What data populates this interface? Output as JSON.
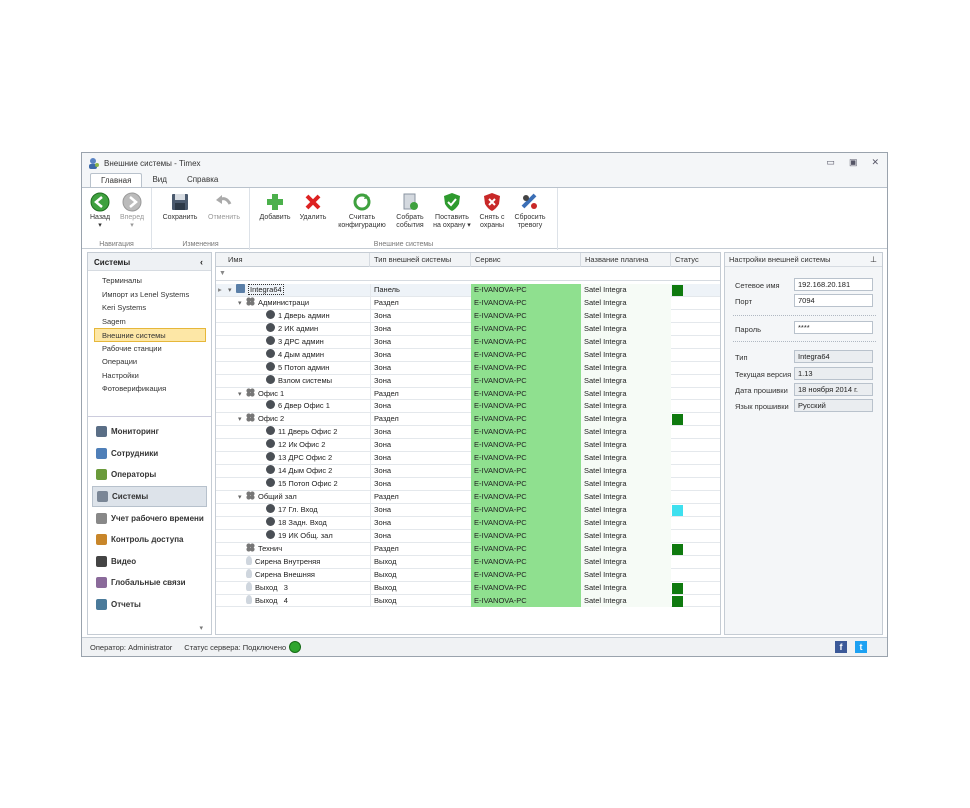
{
  "window": {
    "title": "Внешние системы - Timex"
  },
  "window_controls": [
    "▭",
    "▣",
    "✕"
  ],
  "tabs": [
    {
      "label": "Главная",
      "active": true
    },
    {
      "label": "Вид",
      "active": false
    },
    {
      "label": "Справка",
      "active": false
    }
  ],
  "ribbon": {
    "groups": {
      "navigation": "Навигация",
      "changes": "Изменения",
      "external": "Внешние системы"
    },
    "buttons": {
      "back": "Назад",
      "forward": "Вперед",
      "save": "Сохранить",
      "cancel": "Отменить",
      "add": "Добавить",
      "delete": "Удалить",
      "read_config_1": "Считать",
      "read_config_2": "конфигурацию",
      "collect_events_1": "Собрать",
      "collect_events_2": "события",
      "arm_1": "Поставить",
      "arm_2": "на охрану ▾",
      "disarm_1": "Снять с",
      "disarm_2": "охраны",
      "reset_alarm_1": "Сбросить",
      "reset_alarm_2": "тревогу"
    }
  },
  "sidebar": {
    "header": "Системы",
    "items": [
      "Терминалы",
      "Импорт из Lenel Systems",
      "Keri Systems",
      "Sagem",
      "Внешние системы",
      "Рабочие станции",
      "Операции",
      "Настройки",
      "Фотоверификация"
    ],
    "selected_index": 4,
    "nav": [
      {
        "label": "Мониторинг",
        "icon": "monitor-icon"
      },
      {
        "label": "Сотрудники",
        "icon": "employees-icon"
      },
      {
        "label": "Операторы",
        "icon": "operators-icon"
      },
      {
        "label": "Системы",
        "icon": "systems-icon"
      },
      {
        "label": "Учет рабочего времени",
        "icon": "clock-icon"
      },
      {
        "label": "Контроль доступа",
        "icon": "door-icon"
      },
      {
        "label": "Видео",
        "icon": "video-icon"
      },
      {
        "label": "Глобальные связи",
        "icon": "link-icon"
      },
      {
        "label": "Отчеты",
        "icon": "report-icon"
      }
    ],
    "nav_selected_index": 3
  },
  "grid": {
    "columns": [
      "Имя",
      "Тип внешней системы",
      "Сервис",
      "Название плагина",
      "Статус"
    ],
    "rows": [
      {
        "name": "Integra64",
        "type": "Панель",
        "service": "E-IVANOVA-PC",
        "plugin": "Satel Integra",
        "level": 0,
        "kind": "panel",
        "expand": "▾",
        "status": "#0f7a0f"
      },
      {
        "name": "Администраци",
        "type": "Раздел",
        "service": "E-IVANOVA-PC",
        "plugin": "Satel Integra",
        "level": 1,
        "kind": "partition",
        "expand": "▾",
        "status": ""
      },
      {
        "name": "1 Дверь админ",
        "type": "Зона",
        "service": "E-IVANOVA-PC",
        "plugin": "Satel Integra",
        "level": 2,
        "kind": "zone",
        "expand": "",
        "status": ""
      },
      {
        "name": "2 ИК админ",
        "type": "Зона",
        "service": "E-IVANOVA-PC",
        "plugin": "Satel Integra",
        "level": 2,
        "kind": "zone",
        "expand": "",
        "status": ""
      },
      {
        "name": "3 ДРС админ",
        "type": "Зона",
        "service": "E-IVANOVA-PC",
        "plugin": "Satel Integra",
        "level": 2,
        "kind": "zone",
        "expand": "",
        "status": ""
      },
      {
        "name": "4 Дым админ",
        "type": "Зона",
        "service": "E-IVANOVA-PC",
        "plugin": "Satel Integra",
        "level": 2,
        "kind": "zone",
        "expand": "",
        "status": ""
      },
      {
        "name": "5 Потоп админ",
        "type": "Зона",
        "service": "E-IVANOVA-PC",
        "plugin": "Satel Integra",
        "level": 2,
        "kind": "zone",
        "expand": "",
        "status": ""
      },
      {
        "name": "Взлом системы",
        "type": "Зона",
        "service": "E-IVANOVA-PC",
        "plugin": "Satel Integra",
        "level": 2,
        "kind": "zone",
        "expand": "",
        "status": ""
      },
      {
        "name": "Офис 1",
        "type": "Раздел",
        "service": "E-IVANOVA-PC",
        "plugin": "Satel Integra",
        "level": 1,
        "kind": "partition",
        "expand": "▾",
        "status": ""
      },
      {
        "name": "6 Двер Офис 1",
        "type": "Зона",
        "service": "E-IVANOVA-PC",
        "plugin": "Satel Integra",
        "level": 2,
        "kind": "zone",
        "expand": "",
        "status": ""
      },
      {
        "name": "Офис 2",
        "type": "Раздел",
        "service": "E-IVANOVA-PC",
        "plugin": "Satel Integra",
        "level": 1,
        "kind": "partition",
        "expand": "▾",
        "status": "#0f7a0f"
      },
      {
        "name": "11 Дверь Офис 2",
        "type": "Зона",
        "service": "E-IVANOVA-PC",
        "plugin": "Satel Integra",
        "level": 2,
        "kind": "zone",
        "expand": "",
        "status": ""
      },
      {
        "name": "12 Ик Офис 2",
        "type": "Зона",
        "service": "E-IVANOVA-PC",
        "plugin": "Satel Integra",
        "level": 2,
        "kind": "zone",
        "expand": "",
        "status": ""
      },
      {
        "name": "13 ДРС Офис 2",
        "type": "Зона",
        "service": "E-IVANOVA-PC",
        "plugin": "Satel Integra",
        "level": 2,
        "kind": "zone",
        "expand": "",
        "status": ""
      },
      {
        "name": "14 Дым Офис 2",
        "type": "Зона",
        "service": "E-IVANOVA-PC",
        "plugin": "Satel Integra",
        "level": 2,
        "kind": "zone",
        "expand": "",
        "status": ""
      },
      {
        "name": "15 Потоп Офис 2",
        "type": "Зона",
        "service": "E-IVANOVA-PC",
        "plugin": "Satel Integra",
        "level": 2,
        "kind": "zone",
        "expand": "",
        "status": ""
      },
      {
        "name": "Общий зал",
        "type": "Раздел",
        "service": "E-IVANOVA-PC",
        "plugin": "Satel Integra",
        "level": 1,
        "kind": "partition",
        "expand": "▾",
        "status": ""
      },
      {
        "name": "17 Гл. Вход",
        "type": "Зона",
        "service": "E-IVANOVA-PC",
        "plugin": "Satel Integra",
        "level": 2,
        "kind": "zone",
        "expand": "",
        "status": "#3ee0ef"
      },
      {
        "name": "18 Задн. Вход",
        "type": "Зона",
        "service": "E-IVANOVA-PC",
        "plugin": "Satel Integra",
        "level": 2,
        "kind": "zone",
        "expand": "",
        "status": ""
      },
      {
        "name": "19 ИК Общ. зал",
        "type": "Зона",
        "service": "E-IVANOVA-PC",
        "plugin": "Satel Integra",
        "level": 2,
        "kind": "zone",
        "expand": "",
        "status": ""
      },
      {
        "name": "Технич",
        "type": "Раздел",
        "service": "E-IVANOVA-PC",
        "plugin": "Satel Integra",
        "level": 1,
        "kind": "partition",
        "expand": "",
        "status": "#0f7a0f"
      },
      {
        "name": "Сирена Внутреняя",
        "type": "Выход",
        "service": "E-IVANOVA-PC",
        "plugin": "Satel Integra",
        "level": 1,
        "kind": "output",
        "expand": "",
        "status": ""
      },
      {
        "name": "Сирена Внешняя",
        "type": "Выход",
        "service": "E-IVANOVA-PC",
        "plugin": "Satel Integra",
        "level": 1,
        "kind": "output",
        "expand": "",
        "status": ""
      },
      {
        "name": "Выход   3",
        "type": "Выход",
        "service": "E-IVANOVA-PC",
        "plugin": "Satel Integra",
        "level": 1,
        "kind": "output",
        "expand": "",
        "status": "#0f7a0f"
      },
      {
        "name": "Выход   4",
        "type": "Выход",
        "service": "E-IVANOVA-PC",
        "plugin": "Satel Integra",
        "level": 1,
        "kind": "output",
        "expand": "",
        "status": "#0f7a0f"
      }
    ]
  },
  "properties": {
    "header": "Настройки внешней системы",
    "network_name_label": "Сетевое имя",
    "network_name": "192.168.20.181",
    "port_label": "Порт",
    "port": "7094",
    "password_label": "Пароль",
    "password": "****",
    "type_label": "Тип",
    "type": "Integra64",
    "version_label": "Текущая версия",
    "version": "1.13",
    "firmware_date_label": "Дата прошивки",
    "firmware_date": "18 ноября 2014 г.",
    "firmware_lang_label": "Язык прошивки",
    "firmware_lang": "Русский"
  },
  "status": {
    "operator": "Оператор: Administrator",
    "server": "Статус сервера: Подключено",
    "server_color": "#2ea52e"
  },
  "social": {
    "facebook": "f",
    "twitter": "t"
  },
  "colors": {
    "service_bg": "#8fe08f",
    "selection": "#fde7a6"
  }
}
